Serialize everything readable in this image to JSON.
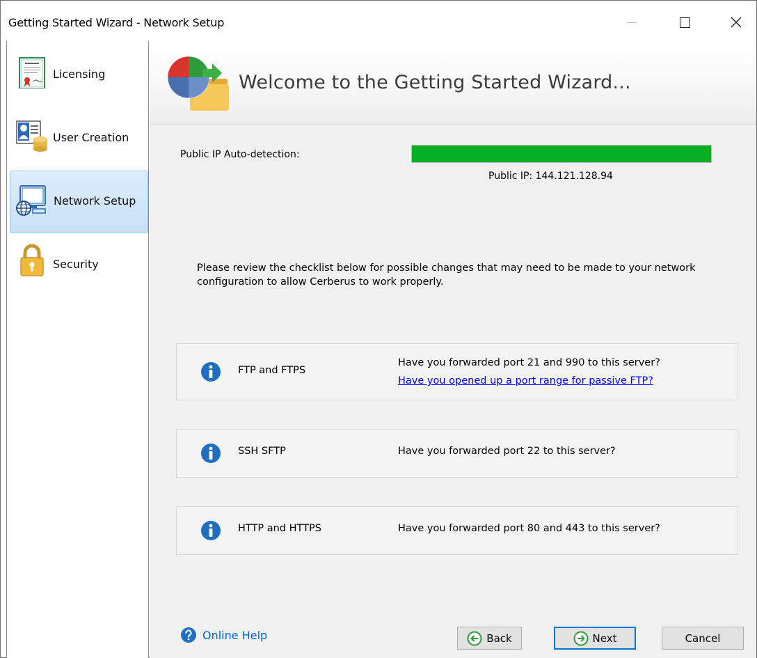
{
  "window": {
    "title": "Getting Started Wizard - Network Setup"
  },
  "sidebar": {
    "items": [
      {
        "label": "Licensing",
        "icon": "certificate-icon",
        "active": false
      },
      {
        "label": "User Creation",
        "icon": "user-database-icon",
        "active": false
      },
      {
        "label": "Network Setup",
        "icon": "network-globe-icon",
        "active": true
      },
      {
        "label": "Security",
        "icon": "padlock-icon",
        "active": false
      }
    ]
  },
  "header": {
    "title": "Welcome to the Getting Started Wizard..."
  },
  "main": {
    "ip_label": "Public IP Auto-detection:",
    "progress": 1.0,
    "ip_text": "Public IP: 144.121.128.94",
    "intro": "Please review the checklist below for possible changes that may need to be made to your network configuration to allow Cerberus to work properly.",
    "checklist": [
      {
        "name": "FTP and FTPS",
        "question": "Have you forwarded port 21 and 990 to this server?",
        "link": "Have you opened up a port range for passive FTP?"
      },
      {
        "name": "SSH SFTP",
        "question": "Have you forwarded port 22 to this server?"
      },
      {
        "name": "HTTP and HTTPS",
        "question": "Have you forwarded port 80 and 443 to this server?"
      }
    ]
  },
  "footer": {
    "help": "Online Help",
    "back": "Back",
    "next": "Next",
    "cancel": "Cancel"
  },
  "colors": {
    "progress_fill": "#06b025",
    "accent": "#0078d7",
    "info_icon": "#1e6fc0",
    "link": "#0000ee"
  }
}
